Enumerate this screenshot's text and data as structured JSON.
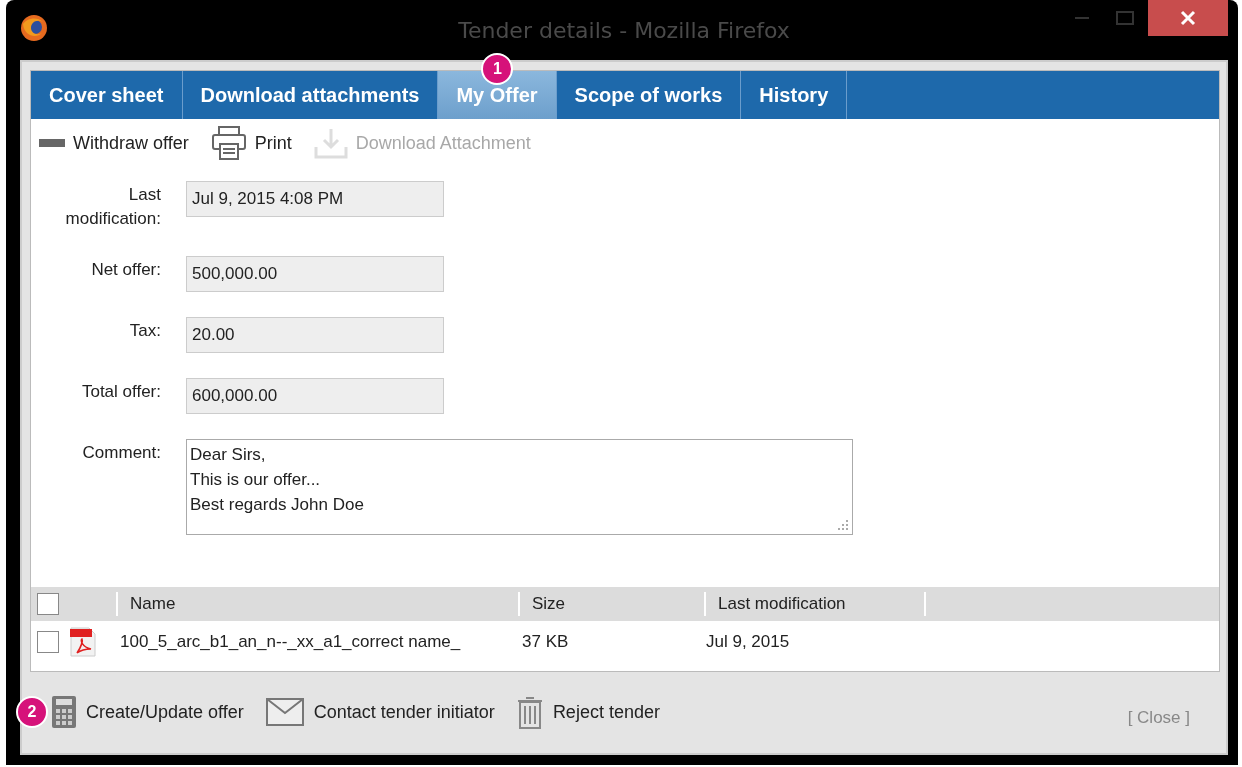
{
  "window": {
    "title": "Tender details - Mozilla Firefox"
  },
  "tabs": [
    {
      "label": "Cover sheet",
      "selected": false
    },
    {
      "label": "Download attachments",
      "selected": false
    },
    {
      "label": "My Offer",
      "selected": true,
      "callout": "1"
    },
    {
      "label": "Scope of works",
      "selected": false
    },
    {
      "label": "History",
      "selected": false
    }
  ],
  "toolbar": [
    {
      "kind": "withdraw",
      "label": "Withdraw offer",
      "disabled": false
    },
    {
      "kind": "print",
      "label": "Print",
      "disabled": false
    },
    {
      "kind": "download",
      "label": "Download Attachment",
      "disabled": true
    }
  ],
  "form": [
    {
      "label": "Last modification:",
      "value": "Jul 9, 2015 4:08 PM"
    },
    {
      "label": "Net offer:",
      "value": "500,000.00"
    },
    {
      "label": "Tax:",
      "value": "20.00"
    },
    {
      "label": "Total offer:",
      "value": "600,000.00"
    }
  ],
  "comment": {
    "label": "Comment:",
    "value": "Dear Sirs,\nThis is our offer...\nBest regards John Doe"
  },
  "table": {
    "select_all": {
      "checked": false
    },
    "columns": [
      "Name",
      "Size",
      "Last modification"
    ],
    "rows": [
      {
        "checked": false,
        "name": "100_5_arc_b1_an_n--_xx_a1_correct name_",
        "size": "37 KB",
        "modified": "Jul 9, 2015"
      }
    ]
  },
  "actions": [
    {
      "kind": "calculator",
      "label": "Create/Update offer",
      "callout": "2"
    },
    {
      "kind": "mail",
      "label": "Contact tender initiator"
    },
    {
      "kind": "trash",
      "label": "Reject tender"
    }
  ],
  "close": "[ Close ]"
}
